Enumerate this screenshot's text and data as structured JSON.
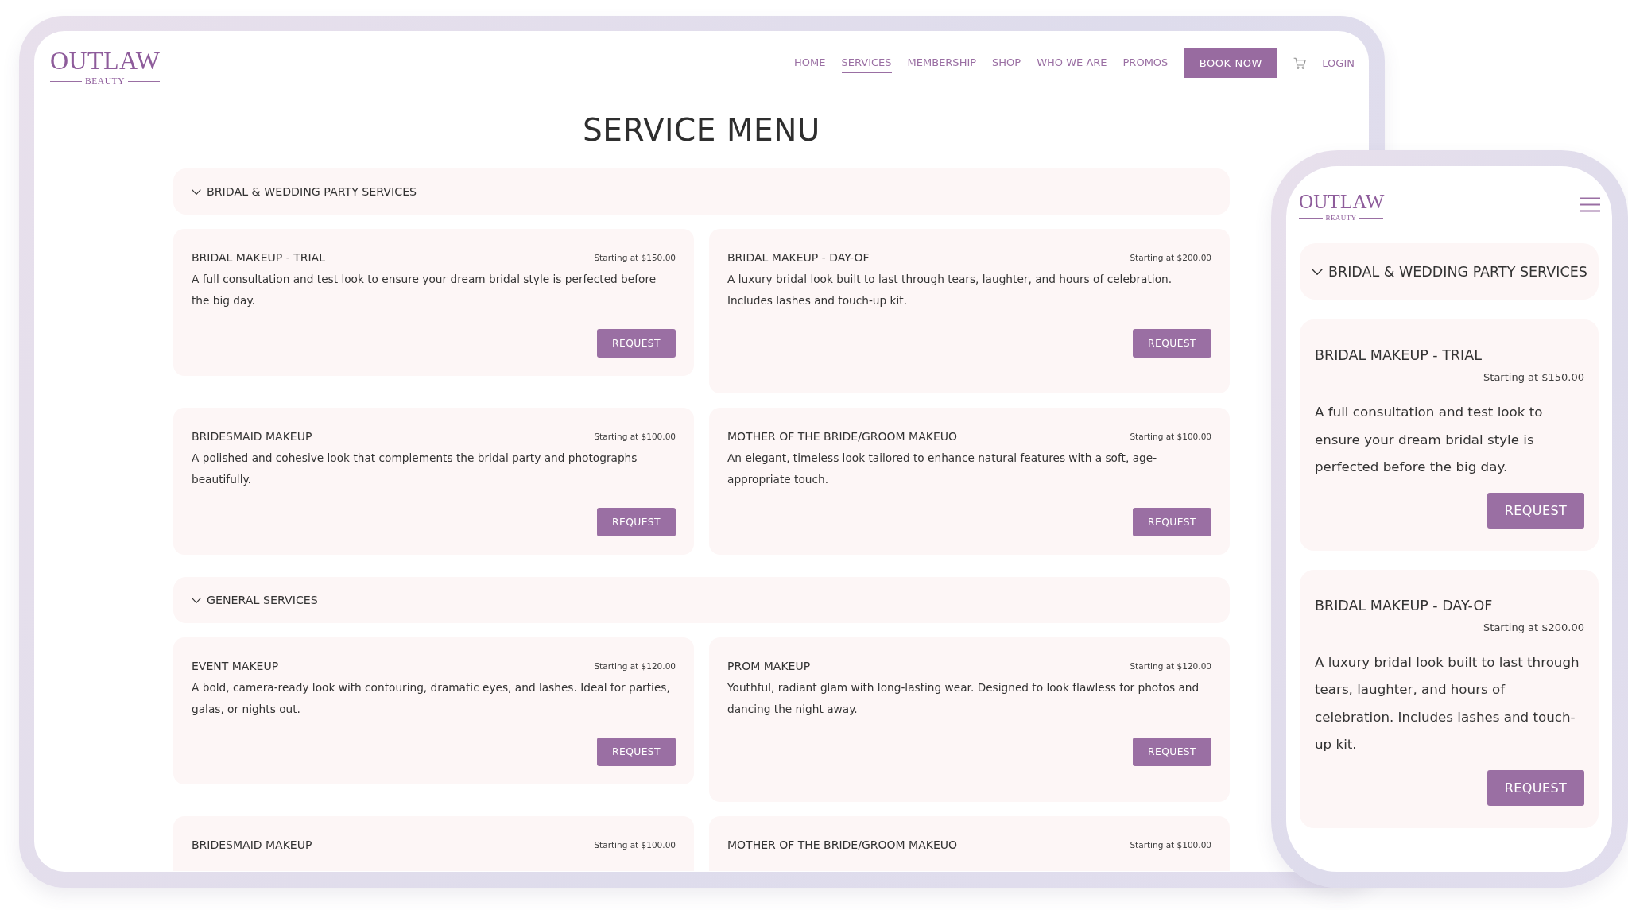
{
  "desktop": {
    "logo": {
      "wordmark": "OUTLAW",
      "tagline": "BEAUTY"
    },
    "nav": [
      {
        "label": "HOME",
        "selected": false
      },
      {
        "label": "SERVICES",
        "selected": true
      },
      {
        "label": "MEMBERSHIP",
        "selected": false
      },
      {
        "label": "SHOP",
        "selected": false
      },
      {
        "label": "WHO WE ARE",
        "selected": false
      },
      {
        "label": "PROMOS",
        "selected": false
      }
    ],
    "book_button": "BOOK NOW",
    "login": "LOGIN",
    "title": "SERVICE MENU",
    "sections": [
      {
        "title": "BRIDAL & WEDDING PARTY SERVICES",
        "expanded": true,
        "services": [
          {
            "name": "BRIDAL MAKEUP - TRIAL",
            "price": "Starting at $150.00",
            "description": "A full consultation and test look to ensure your dream bridal style is perfected before the big day.",
            "button": "REQUEST"
          },
          {
            "name": "BRIDAL MAKEUP - DAY-OF",
            "price": "Starting at $200.00",
            "description": "A luxury bridal look built to last through tears, laughter, and hours of celebration. Includes lashes and touch-up kit.",
            "button": "REQUEST"
          },
          {
            "name": "BRIDESMAID MAKEUP",
            "price": "Starting at $100.00",
            "description": "A polished and cohesive look that complements the bridal party and photographs beautifully.",
            "button": "REQUEST"
          },
          {
            "name": "MOTHER OF THE BRIDE/GROOM MAKEUO",
            "price": "Starting at $100.00",
            "description": "An elegant, timeless look tailored to enhance natural features with a soft, age-appropriate touch.",
            "button": "REQUEST"
          }
        ]
      },
      {
        "title": "GENERAL SERVICES",
        "expanded": true,
        "services": [
          {
            "name": "EVENT MAKEUP",
            "price": "Starting at $120.00",
            "description": "A bold, camera-ready look with contouring, dramatic eyes, and lashes. Ideal for parties, galas, or nights out.",
            "button": "REQUEST"
          },
          {
            "name": "PROM MAKEUP",
            "price": "Starting at $120.00",
            "description": "Youthful, radiant glam with long-lasting wear. Designed to look flawless for photos and dancing the night away.",
            "button": "REQUEST"
          },
          {
            "name": "BRIDESMAID MAKEUP",
            "price": "Starting at $100.00"
          },
          {
            "name": "MOTHER OF THE BRIDE/GROOM MAKEUO",
            "price": "Starting at $100.00"
          }
        ]
      }
    ]
  },
  "mobile": {
    "logo": {
      "wordmark": "OUTLAW",
      "tagline": "BEAUTY"
    },
    "sections": [
      {
        "title": "BRIDAL & WEDDING PARTY SERVICES",
        "expanded": true,
        "services": [
          {
            "name": "BRIDAL MAKEUP - TRIAL",
            "price": "Starting at $150.00",
            "description": "A full consultation and test look to ensure your dream bridal style is perfected before the big day.",
            "button": "REQUEST"
          },
          {
            "name": "BRIDAL MAKEUP - DAY-OF",
            "price": "Starting at $200.00",
            "description": "A luxury bridal look built to last through tears, laughter, and hours of celebration. Includes lashes and touch-up kit.",
            "button": "REQUEST"
          }
        ]
      }
    ]
  }
}
